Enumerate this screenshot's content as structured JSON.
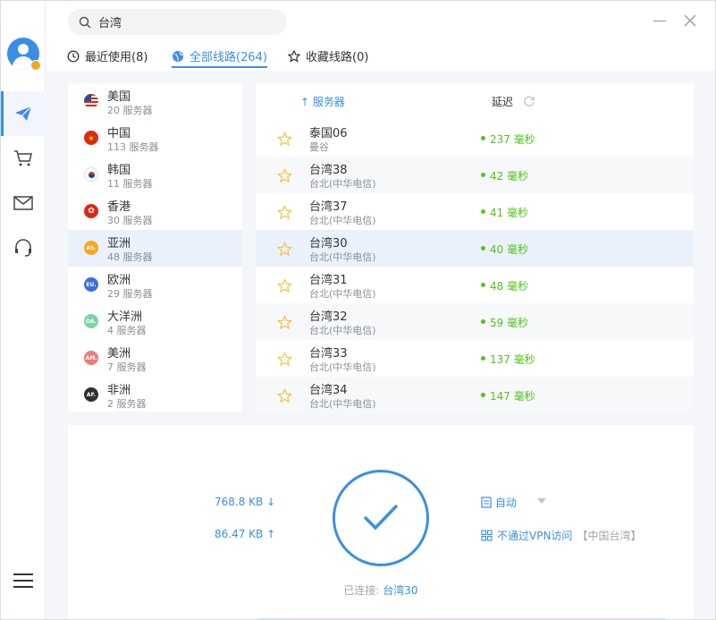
{
  "search": {
    "value": "台湾",
    "placeholder": ""
  },
  "tabs": [
    {
      "label": "最近使用(8)",
      "icon": "clock-icon"
    },
    {
      "label": "全部线路(264)",
      "icon": "globe-icon"
    },
    {
      "label": "收藏线路(0)",
      "icon": "star-icon"
    }
  ],
  "sidebar": {
    "items": [
      "send-icon",
      "cart-icon",
      "mail-icon",
      "headset-icon"
    ]
  },
  "regions": [
    {
      "name": "美国",
      "count": "20 服务器",
      "flag": "US"
    },
    {
      "name": "中国",
      "count": "113 服务器",
      "flag": "CN"
    },
    {
      "name": "韩国",
      "count": "11 服务器",
      "flag": "KR"
    },
    {
      "name": "香港",
      "count": "30 服务器",
      "flag": "HK"
    },
    {
      "name": "亚洲",
      "count": "48 服务器",
      "flag": "AS."
    },
    {
      "name": "欧洲",
      "count": "29 服务器",
      "flag": "EU."
    },
    {
      "name": "大洋洲",
      "count": "4 服务器",
      "flag": "OA."
    },
    {
      "name": "美洲",
      "count": "7 服务器",
      "flag": "AM."
    },
    {
      "name": "非洲",
      "count": "2 服务器",
      "flag": "AF."
    }
  ],
  "server_header": {
    "server": "↑ 服务器",
    "latency": "延迟"
  },
  "servers": [
    {
      "name": "泰国06",
      "location": "曼谷",
      "latency": "237 毫秒"
    },
    {
      "name": "台湾38",
      "location": "台北(中华电信)",
      "latency": "42 毫秒"
    },
    {
      "name": "台湾37",
      "location": "台北(中华电信)",
      "latency": "41 毫秒"
    },
    {
      "name": "台湾30",
      "location": "台北(中华电信)",
      "latency": "40 毫秒"
    },
    {
      "name": "台湾31",
      "location": "台北(中华电信)",
      "latency": "48 毫秒"
    },
    {
      "name": "台湾32",
      "location": "台北(中华电信)",
      "latency": "59 毫秒"
    },
    {
      "name": "台湾33",
      "location": "台北(中华电信)",
      "latency": "137 毫秒"
    },
    {
      "name": "台湾34",
      "location": "台北(中华电信)",
      "latency": "147 毫秒"
    }
  ],
  "traffic": {
    "download": "768.8 KB ↓",
    "upload": "86.47 KB ↑"
  },
  "status": {
    "label": "已连接:",
    "server": "台湾30"
  },
  "mode": {
    "label": "自动"
  },
  "bypass": {
    "label": "不通过VPN访问",
    "hint": "【中国台湾】"
  },
  "colors": {
    "accent": "#3a8ee6",
    "latency_good": "#52c41a",
    "star": "#f5c242"
  }
}
